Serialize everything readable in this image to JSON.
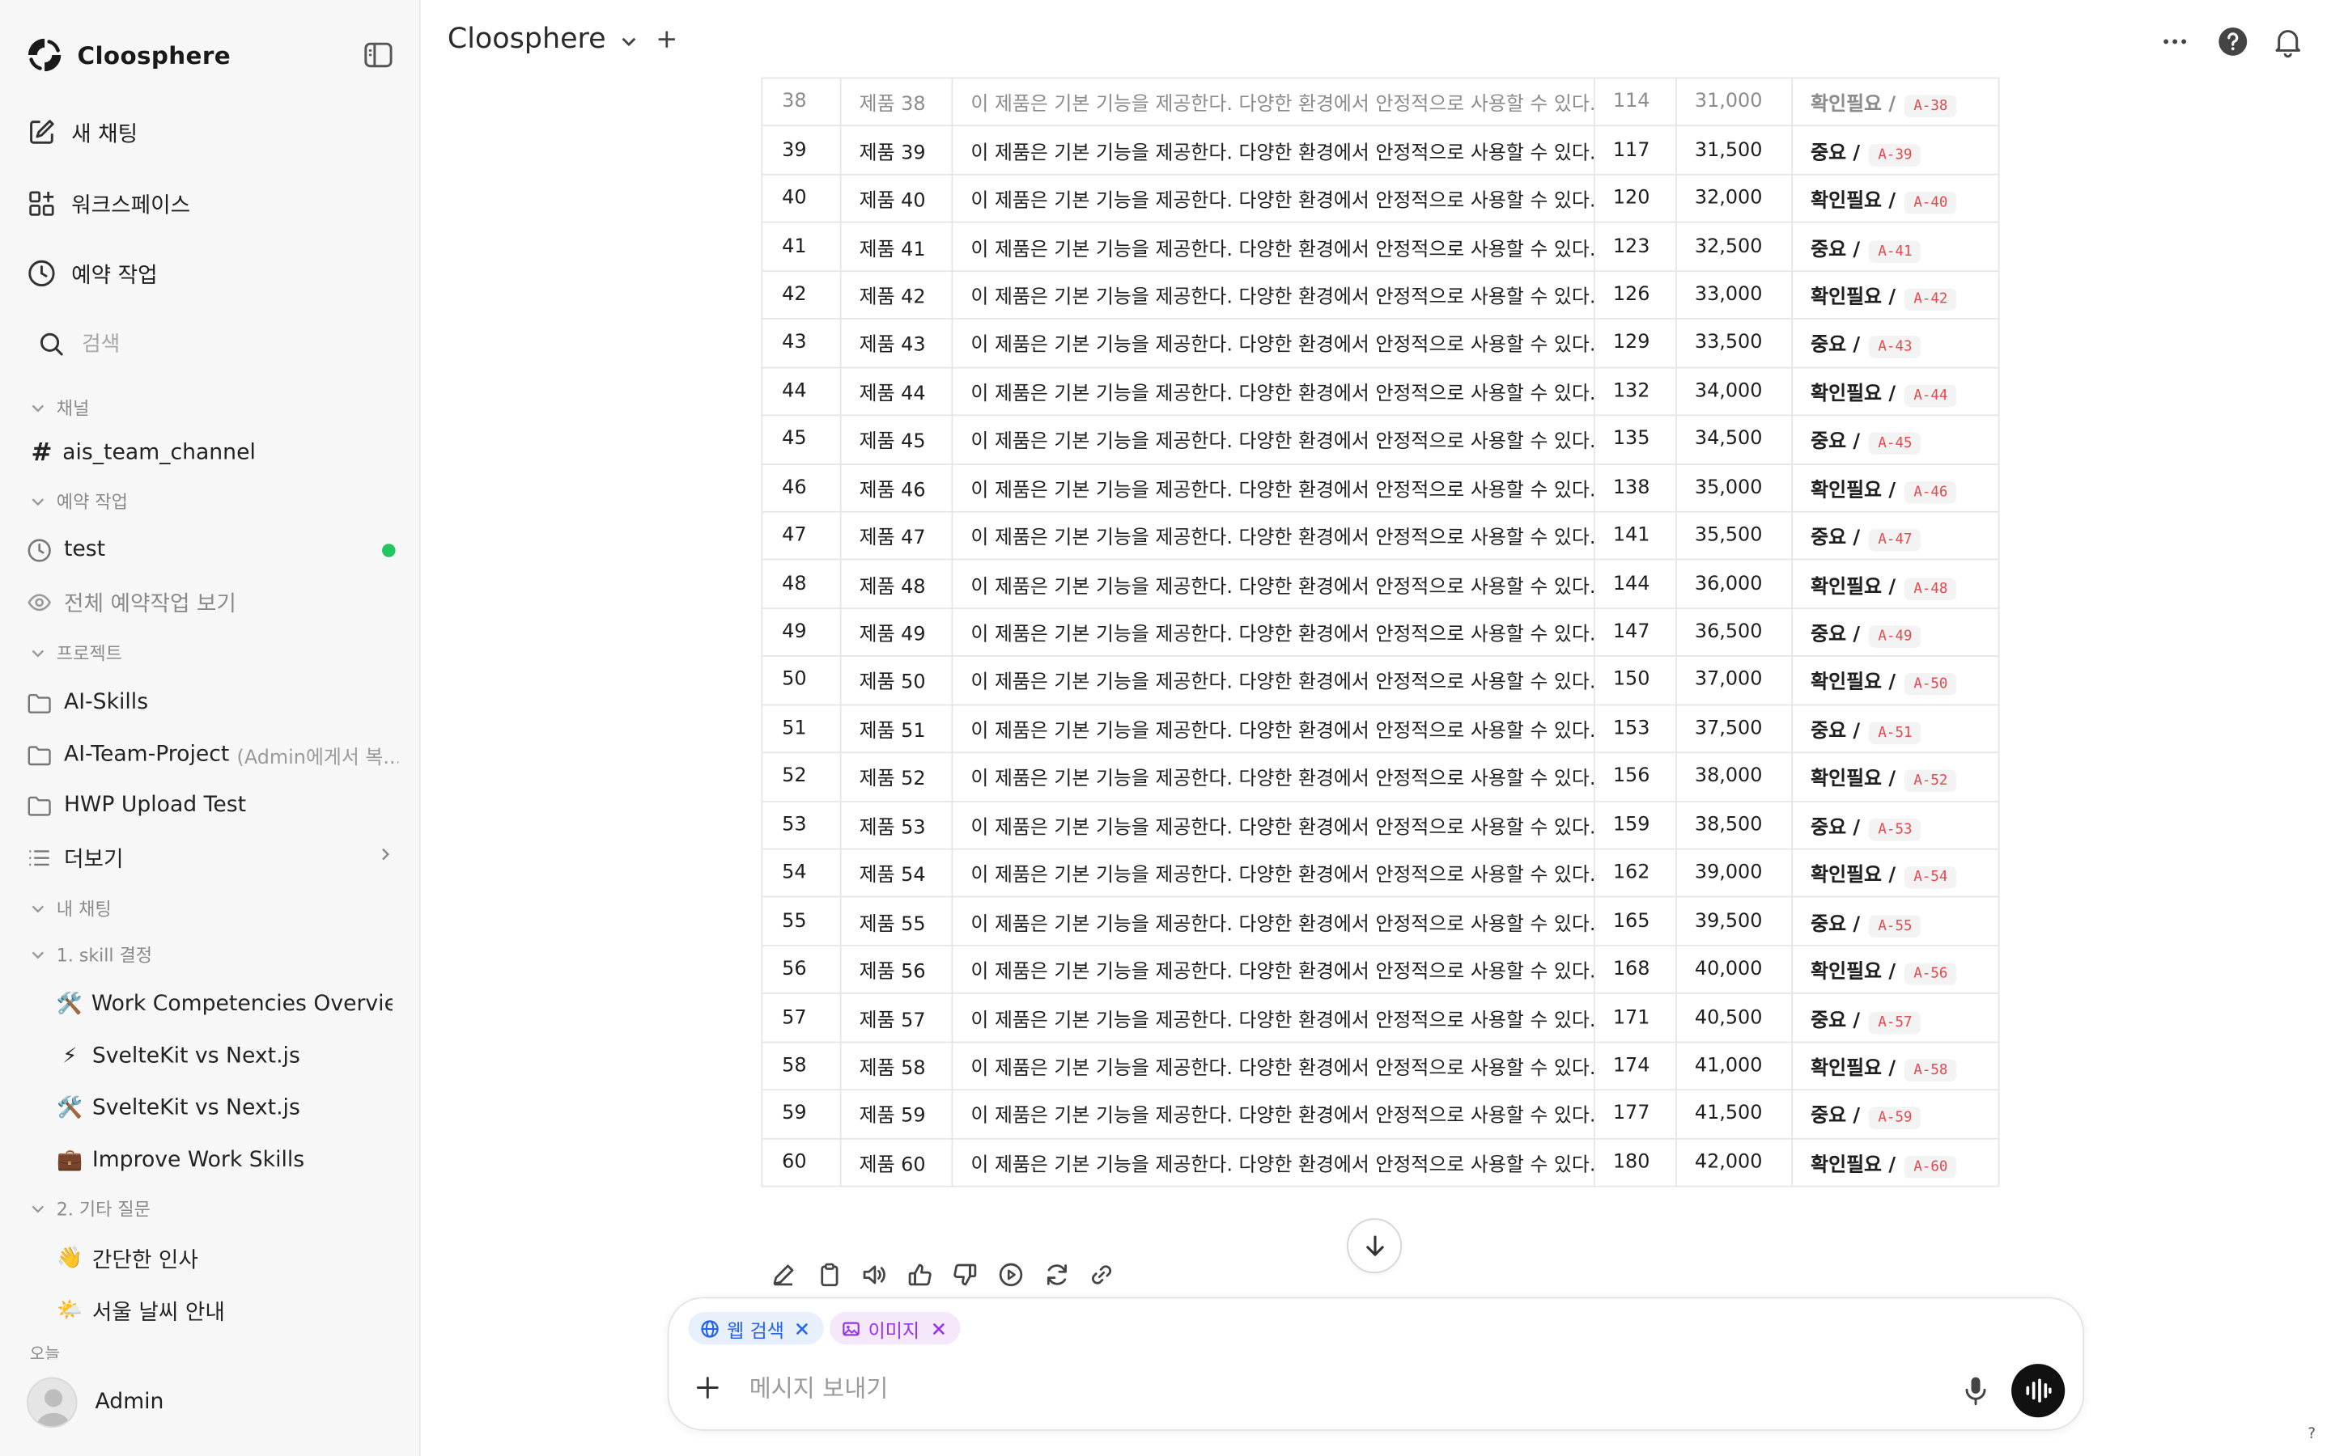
{
  "app": {
    "brand": "Cloosphere",
    "title": "Cloosphere"
  },
  "sidebar": {
    "menu": {
      "new_chat": "새 채팅",
      "workspace": "워크스페이스",
      "scheduled": "예약 작업"
    },
    "search_placeholder": "검색",
    "sections": {
      "channels": "채널",
      "scheduled": "예약 작업",
      "projects": "프로젝트",
      "my_chats": "내 채팅",
      "folder1": "1. skill 결정",
      "folder2": "2. 기타 질문",
      "today": "오늘"
    },
    "channel": "ais_team_channel",
    "scheduled_items": {
      "test": "test",
      "view_all": "전체 예약작업 보기"
    },
    "projects": {
      "p1": "AI-Skills",
      "p2": "AI-Team-Project",
      "p2_suffix": "(Admin에게서 복...",
      "p3": "HWP Upload Test",
      "more": "더보기"
    },
    "chats_folder1": [
      {
        "emoji": "🛠️",
        "title": "Work Competencies Overvie"
      },
      {
        "emoji": "⚡",
        "title": "SvelteKit vs Next.js"
      },
      {
        "emoji": "🛠️",
        "title": "SvelteKit vs Next.js"
      },
      {
        "emoji": "💼",
        "title": "Improve Work Skills"
      }
    ],
    "chats_folder2": [
      {
        "emoji": "👋",
        "title": "간단한 인사"
      },
      {
        "emoji": "🌤️",
        "title": "서울 날씨 안내"
      }
    ],
    "user": {
      "name": "Admin"
    },
    "status_color": "#22c55e"
  },
  "table": {
    "rows": [
      {
        "no": "38",
        "name": "제품 38",
        "desc": "이 제품은 기본 기능을 제공한다. 다양한 환경에서 안정적으로 사용할 수 있다.",
        "qty": "114",
        "price": "31,000",
        "status": "확인필요 /",
        "code": "A-38"
      },
      {
        "no": "39",
        "name": "제품 39",
        "desc": "이 제품은 기본 기능을 제공한다. 다양한 환경에서 안정적으로 사용할 수 있다.",
        "qty": "117",
        "price": "31,500",
        "status": "중요 /",
        "code": "A-39"
      },
      {
        "no": "40",
        "name": "제품 40",
        "desc": "이 제품은 기본 기능을 제공한다. 다양한 환경에서 안정적으로 사용할 수 있다.",
        "qty": "120",
        "price": "32,000",
        "status": "확인필요 /",
        "code": "A-40"
      },
      {
        "no": "41",
        "name": "제품 41",
        "desc": "이 제품은 기본 기능을 제공한다. 다양한 환경에서 안정적으로 사용할 수 있다.",
        "qty": "123",
        "price": "32,500",
        "status": "중요 /",
        "code": "A-41"
      },
      {
        "no": "42",
        "name": "제품 42",
        "desc": "이 제품은 기본 기능을 제공한다. 다양한 환경에서 안정적으로 사용할 수 있다.",
        "qty": "126",
        "price": "33,000",
        "status": "확인필요 /",
        "code": "A-42"
      },
      {
        "no": "43",
        "name": "제품 43",
        "desc": "이 제품은 기본 기능을 제공한다. 다양한 환경에서 안정적으로 사용할 수 있다.",
        "qty": "129",
        "price": "33,500",
        "status": "중요 /",
        "code": "A-43"
      },
      {
        "no": "44",
        "name": "제품 44",
        "desc": "이 제품은 기본 기능을 제공한다. 다양한 환경에서 안정적으로 사용할 수 있다.",
        "qty": "132",
        "price": "34,000",
        "status": "확인필요 /",
        "code": "A-44"
      },
      {
        "no": "45",
        "name": "제품 45",
        "desc": "이 제품은 기본 기능을 제공한다. 다양한 환경에서 안정적으로 사용할 수 있다.",
        "qty": "135",
        "price": "34,500",
        "status": "중요 /",
        "code": "A-45"
      },
      {
        "no": "46",
        "name": "제품 46",
        "desc": "이 제품은 기본 기능을 제공한다. 다양한 환경에서 안정적으로 사용할 수 있다.",
        "qty": "138",
        "price": "35,000",
        "status": "확인필요 /",
        "code": "A-46"
      },
      {
        "no": "47",
        "name": "제품 47",
        "desc": "이 제품은 기본 기능을 제공한다. 다양한 환경에서 안정적으로 사용할 수 있다.",
        "qty": "141",
        "price": "35,500",
        "status": "중요 /",
        "code": "A-47"
      },
      {
        "no": "48",
        "name": "제품 48",
        "desc": "이 제품은 기본 기능을 제공한다. 다양한 환경에서 안정적으로 사용할 수 있다.",
        "qty": "144",
        "price": "36,000",
        "status": "확인필요 /",
        "code": "A-48"
      },
      {
        "no": "49",
        "name": "제품 49",
        "desc": "이 제품은 기본 기능을 제공한다. 다양한 환경에서 안정적으로 사용할 수 있다.",
        "qty": "147",
        "price": "36,500",
        "status": "중요 /",
        "code": "A-49"
      },
      {
        "no": "50",
        "name": "제품 50",
        "desc": "이 제품은 기본 기능을 제공한다. 다양한 환경에서 안정적으로 사용할 수 있다.",
        "qty": "150",
        "price": "37,000",
        "status": "확인필요 /",
        "code": "A-50"
      },
      {
        "no": "51",
        "name": "제품 51",
        "desc": "이 제품은 기본 기능을 제공한다. 다양한 환경에서 안정적으로 사용할 수 있다.",
        "qty": "153",
        "price": "37,500",
        "status": "중요 /",
        "code": "A-51"
      },
      {
        "no": "52",
        "name": "제품 52",
        "desc": "이 제품은 기본 기능을 제공한다. 다양한 환경에서 안정적으로 사용할 수 있다.",
        "qty": "156",
        "price": "38,000",
        "status": "확인필요 /",
        "code": "A-52"
      },
      {
        "no": "53",
        "name": "제품 53",
        "desc": "이 제품은 기본 기능을 제공한다. 다양한 환경에서 안정적으로 사용할 수 있다.",
        "qty": "159",
        "price": "38,500",
        "status": "중요 /",
        "code": "A-53"
      },
      {
        "no": "54",
        "name": "제품 54",
        "desc": "이 제품은 기본 기능을 제공한다. 다양한 환경에서 안정적으로 사용할 수 있다.",
        "qty": "162",
        "price": "39,000",
        "status": "확인필요 /",
        "code": "A-54"
      },
      {
        "no": "55",
        "name": "제품 55",
        "desc": "이 제품은 기본 기능을 제공한다. 다양한 환경에서 안정적으로 사용할 수 있다.",
        "qty": "165",
        "price": "39,500",
        "status": "중요 /",
        "code": "A-55"
      },
      {
        "no": "56",
        "name": "제품 56",
        "desc": "이 제품은 기본 기능을 제공한다. 다양한 환경에서 안정적으로 사용할 수 있다.",
        "qty": "168",
        "price": "40,000",
        "status": "확인필요 /",
        "code": "A-56"
      },
      {
        "no": "57",
        "name": "제품 57",
        "desc": "이 제품은 기본 기능을 제공한다. 다양한 환경에서 안정적으로 사용할 수 있다.",
        "qty": "171",
        "price": "40,500",
        "status": "중요 /",
        "code": "A-57"
      },
      {
        "no": "58",
        "name": "제품 58",
        "desc": "이 제품은 기본 기능을 제공한다. 다양한 환경에서 안정적으로 사용할 수 있다.",
        "qty": "174",
        "price": "41,000",
        "status": "확인필요 /",
        "code": "A-58"
      },
      {
        "no": "59",
        "name": "제품 59",
        "desc": "이 제품은 기본 기능을 제공한다. 다양한 환경에서 안정적으로 사용할 수 있다.",
        "qty": "177",
        "price": "41,500",
        "status": "중요 /",
        "code": "A-59"
      },
      {
        "no": "60",
        "name": "제품 60",
        "desc": "이 제품은 기본 기능을 제공한다. 다양한 환경에서 안정적으로 사용할 수 있다.",
        "qty": "180",
        "price": "42,000",
        "status": "확인필요 /",
        "code": "A-60"
      }
    ]
  },
  "message_actions": [
    "edit-icon",
    "copy-icon",
    "read-aloud-icon",
    "thumbs-up-icon",
    "thumbs-down-icon",
    "continue-icon",
    "regenerate-icon",
    "link-icon"
  ],
  "composer": {
    "chips": {
      "web": "웹 검색",
      "image": "이미지"
    },
    "placeholder": "메시지 보내기"
  },
  "help_mark": "?",
  "colors": {
    "accent": "#2563eb",
    "image_chip": "#9333ea",
    "code_text": "#e5484d"
  }
}
